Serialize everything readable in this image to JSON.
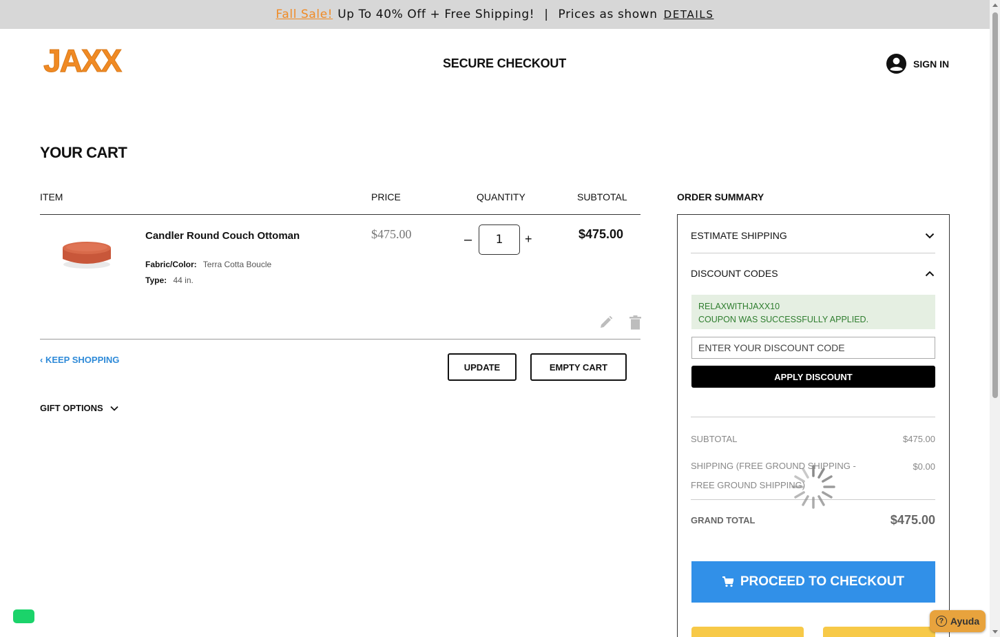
{
  "promo": {
    "sale_link": "Fall Sale!",
    "offer": "Up To 40% Off + Free Shipping!",
    "separator": "|",
    "prices_note": "Prices as shown",
    "details_link": "DETAILS"
  },
  "header": {
    "logo_text": "JAXX",
    "title": "SECURE CHECKOUT",
    "sign_in": "SIGN IN"
  },
  "cart": {
    "title": "YOUR CART",
    "columns": [
      "ITEM",
      "PRICE",
      "QUANTITY",
      "SUBTOTAL"
    ],
    "item": {
      "name": "Candler Round Couch Ottoman",
      "fabric_label": "Fabric/Color:",
      "fabric_value": "Terra Cotta Boucle",
      "type_label": "Type:",
      "type_value": "44 in.",
      "price": "$475.00",
      "qty_minus": "–",
      "quantity": "1",
      "qty_plus": "+",
      "subtotal": "$475.00"
    },
    "keep_shopping": "KEEP SHOPPING",
    "update": "UPDATE",
    "empty_cart": "EMPTY CART",
    "gift_options": "GIFT OPTIONS"
  },
  "summary": {
    "title": "ORDER SUMMARY",
    "estimate_shipping": "ESTIMATE SHIPPING",
    "discount_codes": "DISCOUNT CODES",
    "coupon_code": "RELAXWITHJAXX10",
    "coupon_message": "COUPON WAS SUCCESSFULLY APPLIED.",
    "discount_placeholder": "ENTER YOUR DISCOUNT CODE",
    "apply": "APPLY DISCOUNT",
    "subtotal_label": "SUBTOTAL",
    "subtotal_value": "$475.00",
    "shipping_label": "SHIPPING (FREE GROUND SHIPPING - FREE GROUND SHIPPING)",
    "shipping_value": "$0.00",
    "grand_total_label": "GRAND TOTAL",
    "grand_total_value": "$475.00",
    "proceed": "PROCEED TO CHECKOUT"
  },
  "help": {
    "ayuda": "Ayuda"
  },
  "colors": {
    "accent_orange": "#f08a24",
    "checkout_blue": "#3190e8",
    "success_green": "#2e7d2e"
  }
}
